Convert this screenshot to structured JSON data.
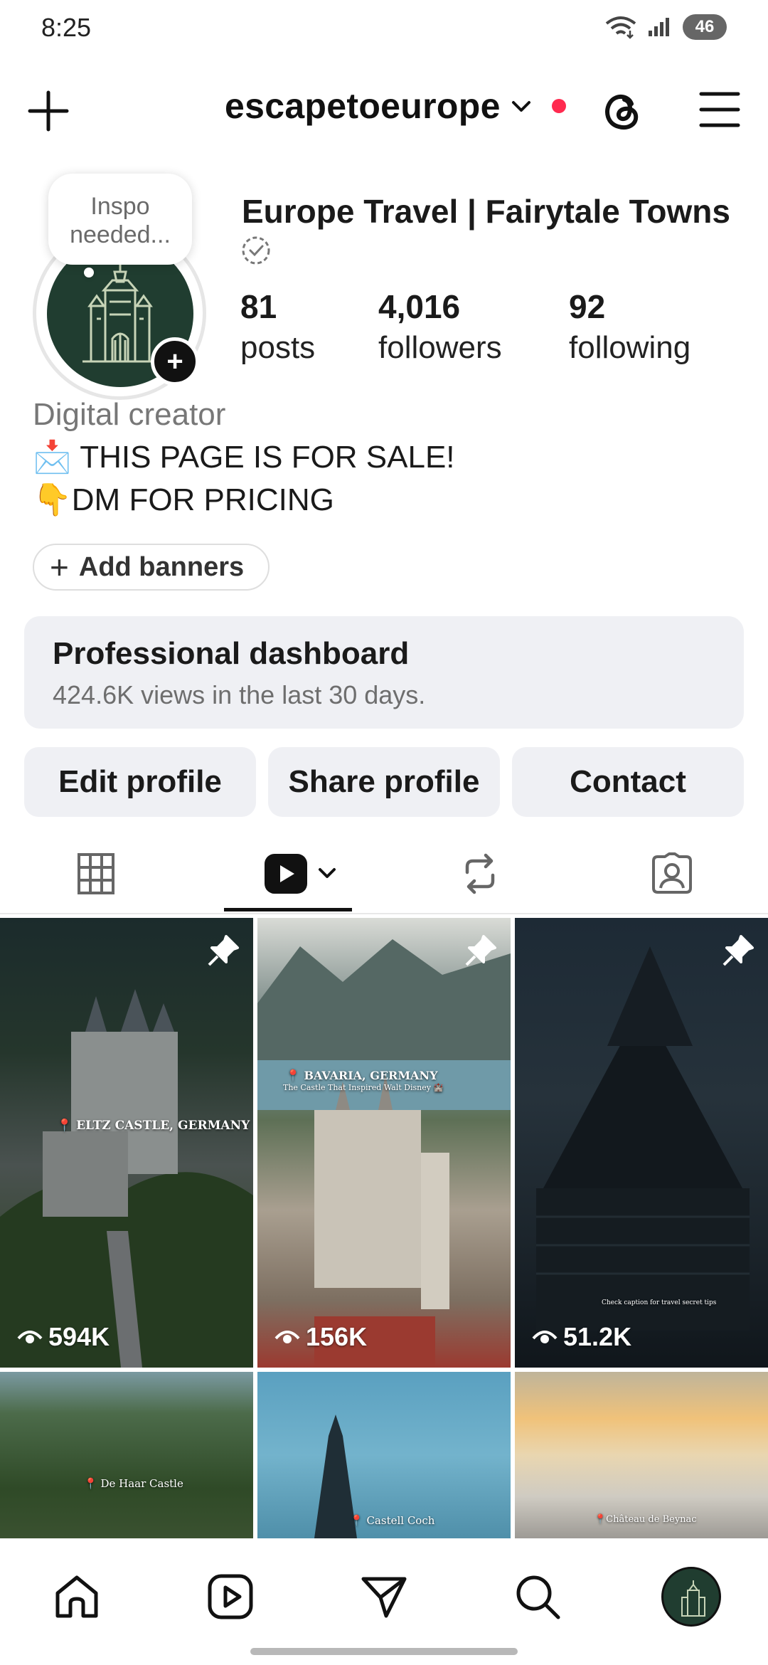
{
  "status": {
    "time": "8:25",
    "battery": "46"
  },
  "header": {
    "username": "escapetoeurope"
  },
  "profile": {
    "display_name": "Europe Travel | Fairytale Towns",
    "note": "Inspo\nneeded...",
    "stats": [
      {
        "value": "81",
        "label": "posts"
      },
      {
        "value": "4,016",
        "label": "followers"
      },
      {
        "value": "92",
        "label": "following"
      }
    ],
    "category": "Digital creator",
    "bio_lines": [
      "📩 THIS PAGE IS FOR SALE!",
      "👇DM FOR PRICING"
    ],
    "add_banners": "Add banners"
  },
  "dashboard": {
    "title": "Professional dashboard",
    "subtitle": "424.6K views in the last 30 days."
  },
  "actions": {
    "edit": "Edit profile",
    "share": "Share profile",
    "contact": "Contact"
  },
  "grid": {
    "tiles": [
      {
        "views": "594K",
        "overlay": "📍 ELTZ CASTLE, GERMANY",
        "pinned": true
      },
      {
        "views": "156K",
        "overlay": "📍 BAVARIA, GERMANY",
        "overlay2": "The Castle That Inspired Walt Disney 🏰",
        "pinned": true
      },
      {
        "views": "51.2K",
        "overlay": "Check caption for travel secret tips",
        "pinned": true
      },
      {
        "overlay": "📍 De Haar Castle"
      },
      {
        "overlay": "📍 Castell Coch"
      },
      {
        "overlay": "📍Château de Beynac"
      }
    ]
  },
  "colors": {
    "accent_red": "#ff2a4f",
    "panel_gray": "#eff0f4",
    "avatar_green": "#203d30"
  },
  "icons": [
    "plus-icon",
    "chevron-down-icon",
    "threads-icon",
    "menu-icon",
    "verified-icon",
    "grid-icon",
    "reels-icon",
    "repost-icon",
    "tagged-icon",
    "pin-icon",
    "eye-icon",
    "home-icon",
    "share-icon",
    "search-icon"
  ]
}
